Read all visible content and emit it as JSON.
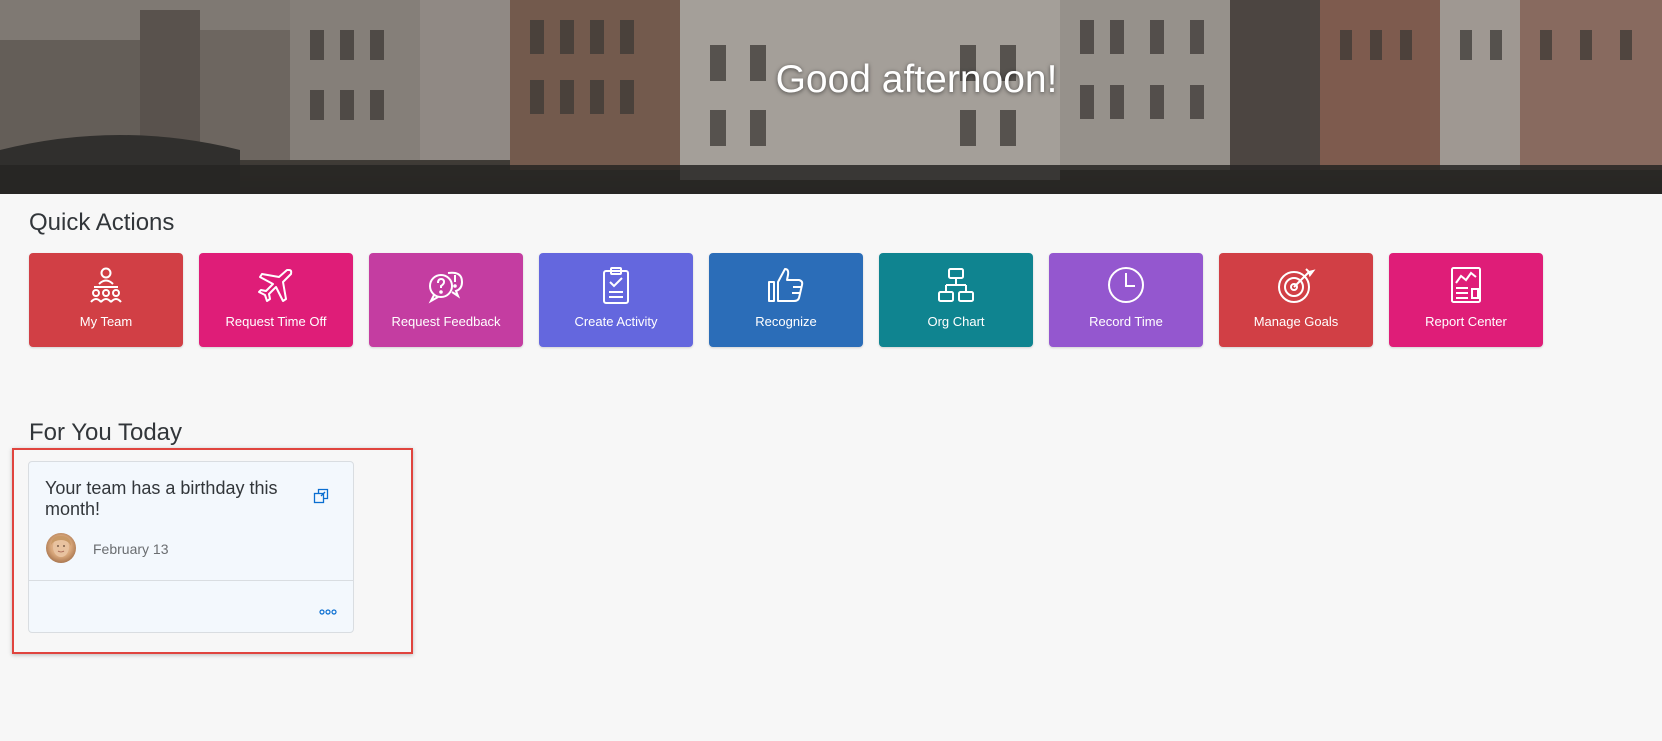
{
  "hero": {
    "greeting": "Good afternoon!"
  },
  "quick_actions": {
    "title": "Quick Actions",
    "tiles": [
      {
        "label": "My Team",
        "icon": "team-icon",
        "color": "#d13f45"
      },
      {
        "label": "Request Time Off",
        "icon": "airplane-icon",
        "color": "#df1d78"
      },
      {
        "label": "Request Feedback",
        "icon": "feedback-icon",
        "color": "#c43da1"
      },
      {
        "label": "Create Activity",
        "icon": "clipboard-check-icon",
        "color": "#6467de"
      },
      {
        "label": "Recognize",
        "icon": "thumbs-up-icon",
        "color": "#2b6db8"
      },
      {
        "label": "Org Chart",
        "icon": "org-chart-icon",
        "color": "#0f8490"
      },
      {
        "label": "Record Time",
        "icon": "clock-icon",
        "color": "#9457cf"
      },
      {
        "label": "Manage Goals",
        "icon": "target-icon",
        "color": "#d13f45"
      },
      {
        "label": "Report Center",
        "icon": "report-icon",
        "color": "#df1d78"
      }
    ]
  },
  "for_you_today": {
    "title": "For You Today",
    "card": {
      "title": "Your team has a birthday this month!",
      "date": "February 13",
      "open_icon": "open-in-new-icon",
      "more_icon": "more-icon"
    }
  },
  "colors": {
    "highlight_border": "#e0443e",
    "card_background": "#f3f8fd",
    "page_background": "#f7f7f7"
  }
}
